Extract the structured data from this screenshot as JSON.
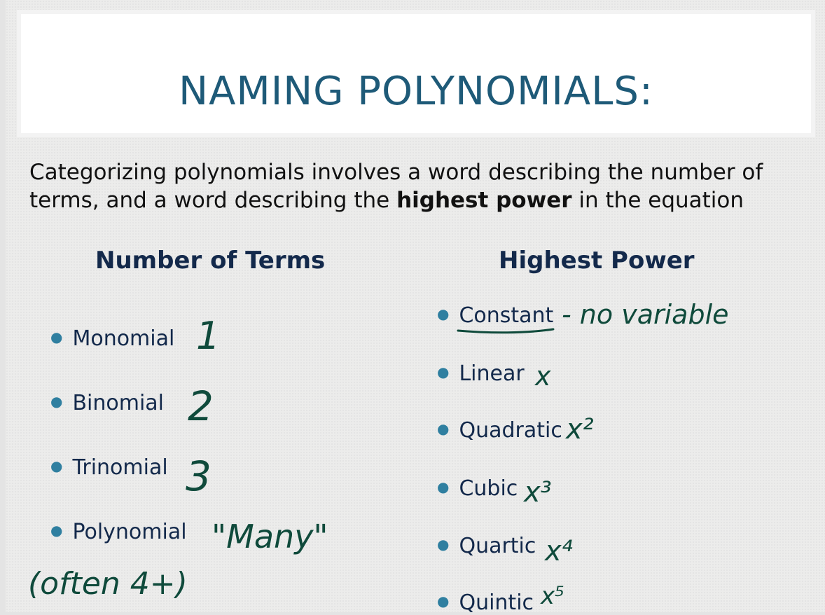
{
  "slide": {
    "title": "NAMING POLYNOMIALS:",
    "intro": {
      "part1": "Categorizing polynomials involves a word describing the number of terms, and a word describing the ",
      "bold": "highest power",
      "part2": " in the equation"
    },
    "left_column": {
      "heading": "Number of Terms",
      "items": [
        "Monomial",
        "Binomial",
        "Trinomial",
        "Polynomial"
      ]
    },
    "right_column": {
      "heading": "Highest Power",
      "items": [
        "Constant",
        "Linear",
        "Quadratic",
        "Cubic",
        "Quartic",
        "Quintic"
      ]
    },
    "annotations": {
      "monomial": "1",
      "binomial": "2",
      "trinomial": "3",
      "polynomial": "\"Many\"",
      "polynomial_note": "(often 4+)",
      "constant": "- no variable",
      "linear": "x",
      "quadratic": "x²",
      "cubic": "x³",
      "quartic": "x⁴",
      "quintic": "x⁵"
    },
    "colors": {
      "title": "#1e5a78",
      "heading": "#13294b",
      "bullet": "#2f7fa0",
      "handwriting": "#0f4a3b"
    }
  }
}
